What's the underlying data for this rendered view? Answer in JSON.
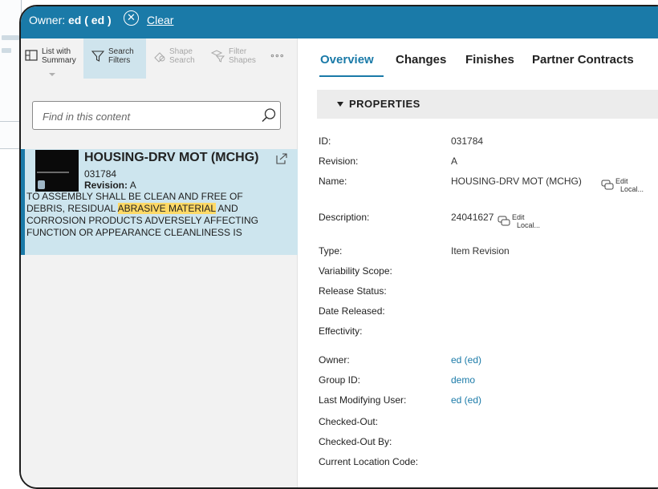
{
  "topbar": {
    "owner_prefix": "Owner:",
    "owner_value": "ed ( ed )",
    "clear_label": "Clear"
  },
  "toolbar": {
    "list_summary": [
      "List with",
      "Summary"
    ],
    "search_filters": [
      "Search",
      "Filters"
    ],
    "shape_search": [
      "Shape",
      "Search"
    ],
    "filter_shapes": [
      "Filter",
      "Shapes"
    ],
    "more": "∘∘∘"
  },
  "search": {
    "placeholder": "Find in this content"
  },
  "result": {
    "title": "HOUSING-DRV MOT (MCHG)",
    "id": "031784",
    "revision_label": "Revision:",
    "revision_value": "A",
    "desc_line1": "TO ASSEMBLY SHALL BE CLEAN AND FREE OF",
    "desc_line2_pre": "DEBRIS, RESIDUAL ",
    "desc_line2_hl": "ABRASIVE MATERIAL",
    "desc_line2_post": " AND",
    "desc_line3": "CORROSION PRODUCTS ADVERSELY AFFECTING",
    "desc_line4": "FUNCTION OR APPEARANCE CLEANLINESS IS"
  },
  "tabs": [
    "Overview",
    "Changes",
    "Finishes",
    "Partner Contracts"
  ],
  "section_title": "PROPERTIES",
  "edit": {
    "line1": "Edit",
    "line2": "Local..."
  },
  "properties": {
    "id": {
      "label": "ID:",
      "value": "031784"
    },
    "revision": {
      "label": "Revision:",
      "value": "A"
    },
    "name": {
      "label": "Name:",
      "value": "HOUSING-DRV MOT (MCHG)"
    },
    "description": {
      "label": "Description:",
      "value": "24041627"
    },
    "type": {
      "label": "Type:",
      "value": "Item Revision"
    },
    "variability": {
      "label": "Variability Scope:",
      "value": ""
    },
    "release_status": {
      "label": "Release Status:",
      "value": ""
    },
    "date_released": {
      "label": "Date Released:",
      "value": ""
    },
    "effectivity": {
      "label": "Effectivity:",
      "value": ""
    },
    "owner": {
      "label": "Owner:",
      "value": "ed (ed)"
    },
    "group": {
      "label": "Group ID:",
      "value": "demo"
    },
    "last_user": {
      "label": "Last Modifying User:",
      "value": "ed (ed)"
    },
    "checked_out": {
      "label": "Checked-Out:",
      "value": ""
    },
    "checked_out_by": {
      "label": "Checked-Out By:",
      "value": ""
    },
    "location": {
      "label": "Current Location Code:",
      "value": ""
    }
  },
  "colors": {
    "accent": "#1a7aa8",
    "selected_row": "#cde5ee",
    "highlight": "#ffd966"
  }
}
